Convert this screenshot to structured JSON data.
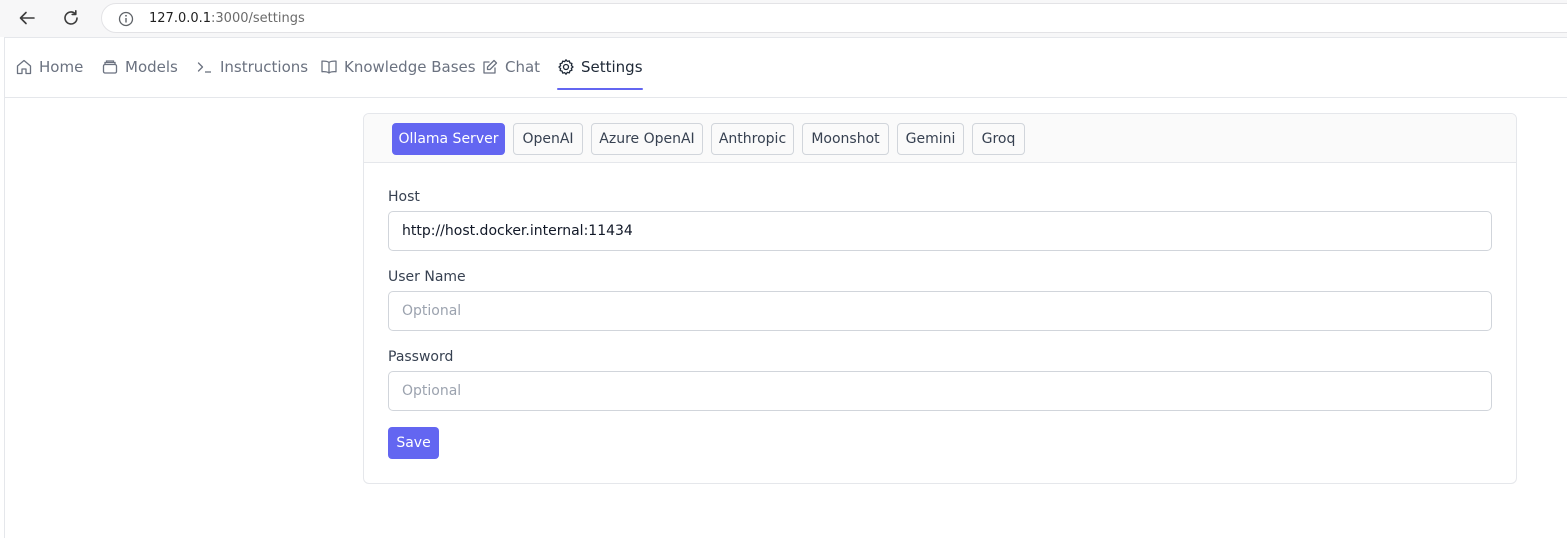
{
  "browser": {
    "url_host": "127.0.0.1",
    "url_path": ":3000/settings"
  },
  "nav": {
    "items": [
      {
        "label": "Home",
        "icon": "home-icon"
      },
      {
        "label": "Models",
        "icon": "models-icon"
      },
      {
        "label": "Instructions",
        "icon": "terminal-icon"
      },
      {
        "label": "Knowledge Bases",
        "icon": "book-icon"
      },
      {
        "label": "Chat",
        "icon": "edit-icon"
      },
      {
        "label": "Settings",
        "icon": "gear-icon",
        "active": true
      }
    ]
  },
  "settings": {
    "tabs": [
      {
        "label": "Ollama Server",
        "active": true
      },
      {
        "label": "OpenAI"
      },
      {
        "label": "Azure OpenAI"
      },
      {
        "label": "Anthropic"
      },
      {
        "label": "Moonshot"
      },
      {
        "label": "Gemini"
      },
      {
        "label": "Groq"
      }
    ],
    "host": {
      "label": "Host",
      "value": "http://host.docker.internal:11434"
    },
    "username": {
      "label": "User Name",
      "placeholder": "Optional"
    },
    "password": {
      "label": "Password",
      "placeholder": "Optional"
    },
    "save_label": "Save"
  },
  "colors": {
    "accent": "#6366f1",
    "border": "#e5e7eb"
  }
}
